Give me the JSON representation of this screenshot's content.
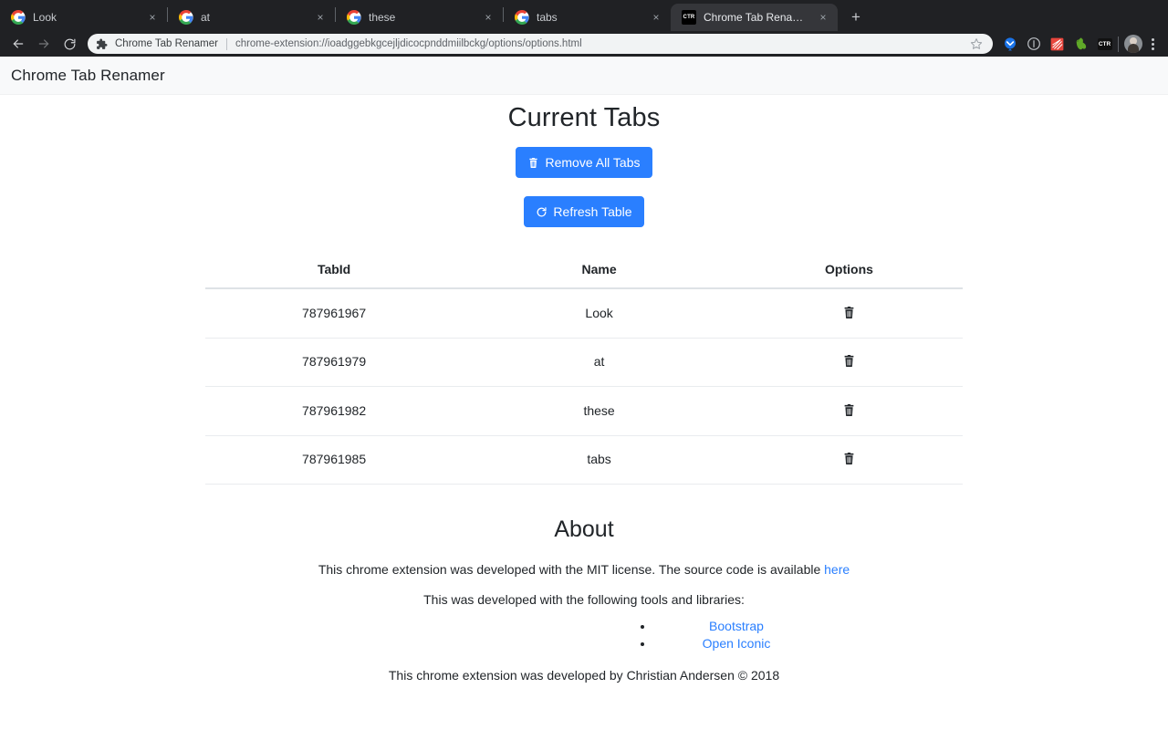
{
  "browser": {
    "tabs": [
      {
        "title": "Look",
        "favicon": "google-g-icon",
        "active": false,
        "close_label": "×"
      },
      {
        "title": "at",
        "favicon": "google-g-icon",
        "active": false,
        "close_label": "×"
      },
      {
        "title": "these",
        "favicon": "google-g-icon",
        "active": false,
        "close_label": "×"
      },
      {
        "title": "tabs",
        "favicon": "google-g-icon",
        "active": false,
        "close_label": "×"
      },
      {
        "title": "Chrome Tab Renamer Options",
        "favicon": "ctr-icon",
        "favicon_text": "CTR",
        "active": true,
        "close_label": "×"
      }
    ],
    "new_tab_label": "+",
    "toolbar": {
      "back_label": "←",
      "forward_label": "→",
      "reload_label": "↻",
      "extension_name": "Chrome Tab Renamer",
      "url": "chrome-extension://ioadggebkgcejljdicocpnddmiilbckg/options/options.html",
      "bookmark_icon": "star-icon",
      "extension_icons": [
        {
          "name": "pocket-icon"
        },
        {
          "name": "info-circle-icon"
        },
        {
          "name": "red-stripes-icon"
        },
        {
          "name": "evernote-elephant-icon"
        },
        {
          "name": "ctr-extension-icon",
          "label": "CTR"
        }
      ],
      "profile_icon": "avatar",
      "menu_icon": "three-dot-menu-icon"
    }
  },
  "page": {
    "navbar_brand": "Chrome Tab Renamer",
    "heading": "Current Tabs",
    "remove_all_label": "Remove All Tabs",
    "remove_all_icon": "trash-icon",
    "refresh_label": "Refresh Table",
    "refresh_icon": "reload-icon",
    "table": {
      "columns": [
        "TabId",
        "Name",
        "Options"
      ],
      "rows": [
        {
          "tabid": "787961967",
          "name": "Look",
          "delete_icon": "trash-icon"
        },
        {
          "tabid": "787961979",
          "name": "at",
          "delete_icon": "trash-icon"
        },
        {
          "tabid": "787961982",
          "name": "these",
          "delete_icon": "trash-icon"
        },
        {
          "tabid": "787961985",
          "name": "tabs",
          "delete_icon": "trash-icon"
        }
      ]
    },
    "about": {
      "heading": "About",
      "license_text_before": "This chrome extension was developed with the MIT license. The source code is available ",
      "license_link": "here",
      "tools_intro": "This was developed with the following tools and libraries:",
      "tools": [
        {
          "label": "Bootstrap"
        },
        {
          "label": "Open Iconic"
        }
      ],
      "footer": "This chrome extension was developed by Christian Andersen © 2018"
    }
  },
  "colors": {
    "primary": "#2a7fff",
    "link": "#2a7fff",
    "navbar_bg": "#f8f9fa",
    "chrome_bg": "#202124",
    "active_tab_bg": "#35363a",
    "table_border": "#dee2e6"
  }
}
